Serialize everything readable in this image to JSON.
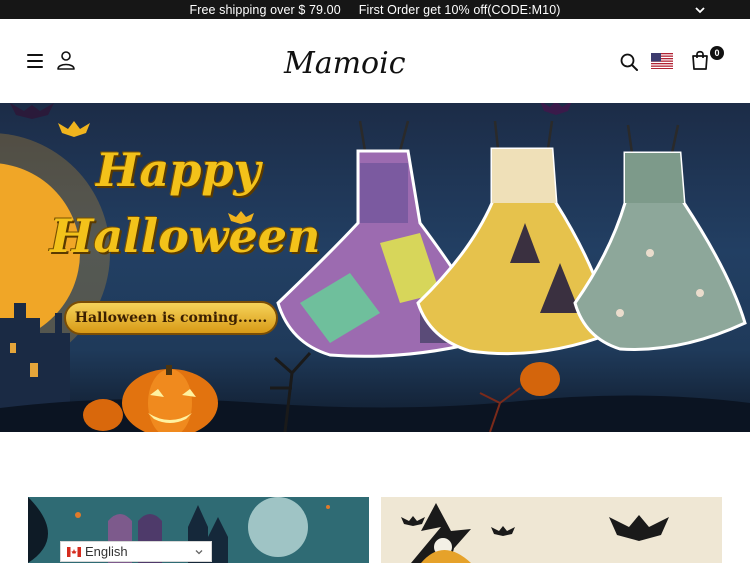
{
  "announcement": {
    "shipping": "Free shipping over $ 79.00",
    "offer": "First Order get 10% off(CODE:M10)"
  },
  "header": {
    "logo": "Mamoic",
    "cart_count": "0"
  },
  "hero": {
    "title_line1": "Happy",
    "title_line2": "Halloween",
    "pill": "Halloween is coming......"
  },
  "language": {
    "selected": "English"
  },
  "colors": {
    "announce_bg": "#161616",
    "hero_text": "#f3c21a"
  }
}
